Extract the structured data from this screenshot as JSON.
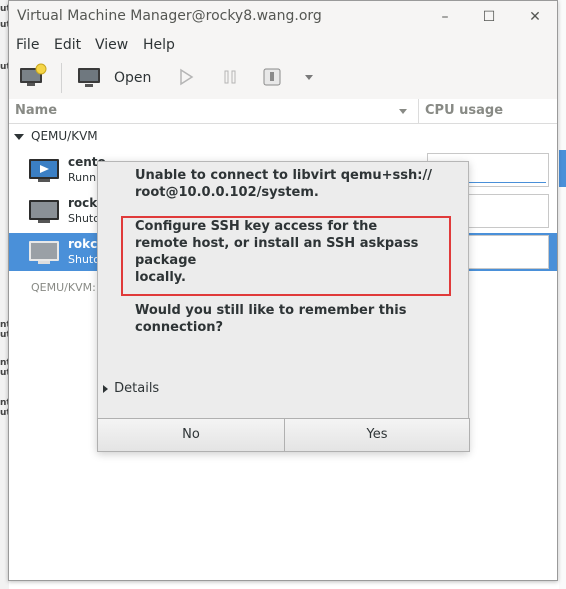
{
  "window": {
    "title": "Virtual Machine Manager@rocky8.wang.org",
    "minimize": "–",
    "maximize": "☐",
    "close": "✕"
  },
  "menu": [
    "File",
    "Edit",
    "View",
    "Help"
  ],
  "toolbar": {
    "open_label": "Open"
  },
  "list": {
    "col_name": "Name",
    "col_cpu": "CPU usage",
    "group": "QEMU/KVM",
    "vms": [
      {
        "name": "cento",
        "status": "Runn",
        "icon": "running-vm-icon"
      },
      {
        "name": "rocky",
        "status": "Shuto",
        "icon": "shutoff-vm-icon"
      },
      {
        "name": "rokcy",
        "status": "Shuto",
        "icon": "shutoff-vm-icon"
      }
    ],
    "uri_label": "QEMU/KVM:"
  },
  "dialog": {
    "line1": "Unable to connect to libvirt qemu+ssh://\nroot@10.0.0.102/system.",
    "line2": "Configure SSH key access for the\nremote host, or install an SSH askpass\npackage\nlocally.",
    "line3": "Would you still like to remember this\nconnection?",
    "details": "Details",
    "no": "No",
    "yes": "Yes"
  },
  "colors": {
    "selection": "#4a90d9",
    "highlight_border": "#e03a3a"
  }
}
